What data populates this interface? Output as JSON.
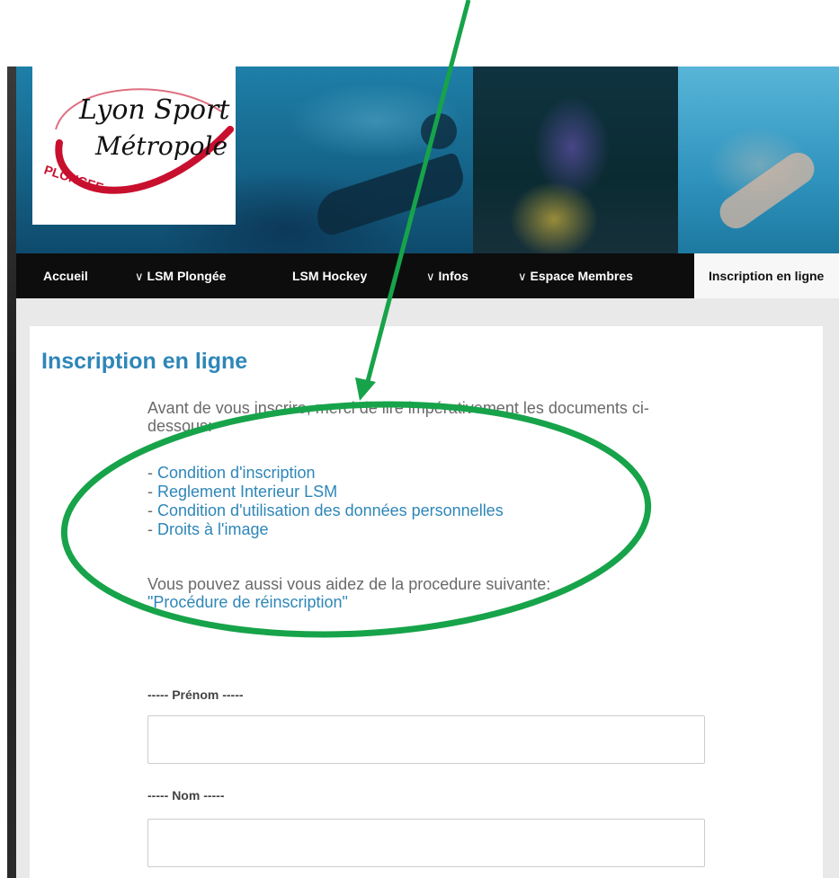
{
  "logo": {
    "line1": "Lyon Sport",
    "line2": "Métropole",
    "subtitle": "PLONGEE"
  },
  "nav": {
    "items": [
      {
        "label": "Accueil",
        "has_dropdown": false
      },
      {
        "label": "LSM Plongée",
        "has_dropdown": true
      },
      {
        "label": "LSM Hockey",
        "has_dropdown": false
      },
      {
        "label": "Infos",
        "has_dropdown": true
      },
      {
        "label": "Espace Membres",
        "has_dropdown": true
      },
      {
        "label": "Inscription en ligne",
        "has_dropdown": false,
        "active": true
      }
    ],
    "chevron": "∨"
  },
  "page": {
    "title": "Inscription en ligne",
    "intro": "Avant de vous inscrire, merci de lire impérativement les documents ci-dessous:",
    "documents": [
      "Condition d'inscription",
      "Reglement Interieur LSM",
      "Condition d'utilisation des données personnelles",
      "Droits à l'image"
    ],
    "bullet": "- ",
    "help_text": "Vous pouvez aussi vous aidez de la procedure suivante:",
    "help_link": "\"Procédure de réinscription\""
  },
  "form": {
    "fields": [
      {
        "label": "----- Prénom -----",
        "value": ""
      },
      {
        "label": "----- Nom -----",
        "value": ""
      }
    ]
  },
  "annotation": {
    "color": "#17a34a",
    "shapes": [
      "arrow",
      "ellipse"
    ]
  }
}
